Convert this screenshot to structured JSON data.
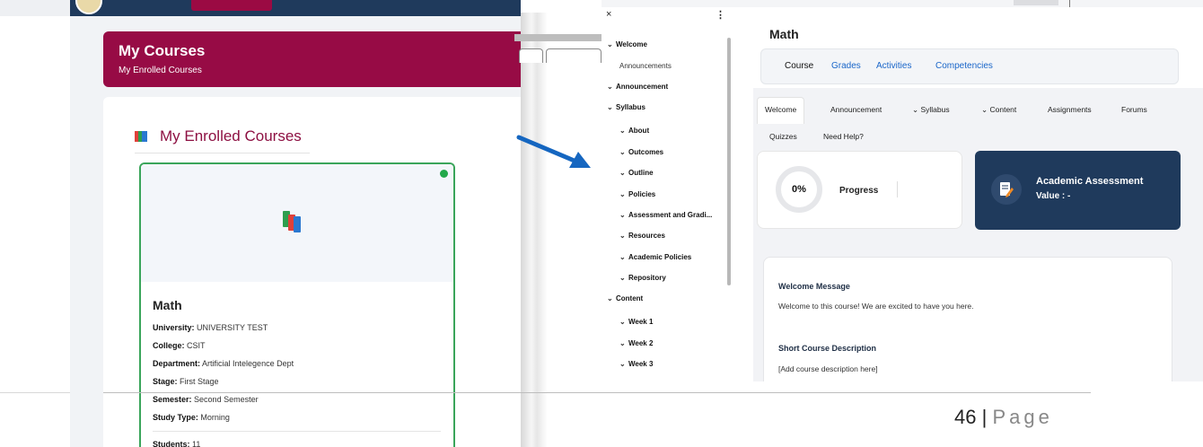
{
  "left_screen": {
    "banner": {
      "title": "My Courses",
      "subtitle": "My Enrolled Courses"
    },
    "section_title": "My Enrolled Courses",
    "course": {
      "name": "Math",
      "status_color": "#22a84a",
      "fields": [
        {
          "label": "University:",
          "value": "UNIVERSITY TEST"
        },
        {
          "label": "College:",
          "value": "CSIT"
        },
        {
          "label": "Department:",
          "value": "Artificial Intelegence Dept"
        },
        {
          "label": "Stage:",
          "value": "First Stage"
        },
        {
          "label": "Semester:",
          "value": "Second Semester"
        },
        {
          "label": "Study Type:",
          "value": "Morning"
        }
      ],
      "students": {
        "label": "Students:",
        "value": "11"
      }
    }
  },
  "right_screen": {
    "sidebar": {
      "close_glyph": "×",
      "more_glyph": "⋮",
      "items": [
        {
          "label": "Welcome",
          "level": 0,
          "chevron": "⌄"
        },
        {
          "label": "Announcements",
          "level": 2,
          "chevron": ""
        },
        {
          "label": "Announcement",
          "level": 0,
          "chevron": "⌄"
        },
        {
          "label": "Syllabus",
          "level": 0,
          "chevron": "⌄"
        },
        {
          "label": "About",
          "level": 1,
          "chevron": "⌄"
        },
        {
          "label": "Outcomes",
          "level": 1,
          "chevron": "⌄"
        },
        {
          "label": "Outline",
          "level": 1,
          "chevron": "⌄"
        },
        {
          "label": "Policies",
          "level": 1,
          "chevron": "⌄"
        },
        {
          "label": "Assessment and Gradi...",
          "level": 1,
          "chevron": "⌄"
        },
        {
          "label": "Resources",
          "level": 1,
          "chevron": "⌄"
        },
        {
          "label": "Academic Policies",
          "level": 1,
          "chevron": "⌄"
        },
        {
          "label": "Repository",
          "level": 1,
          "chevron": "⌄"
        },
        {
          "label": "Content",
          "level": 0,
          "chevron": "⌄"
        },
        {
          "label": "Week 1",
          "level": 1,
          "chevron": "⌄"
        },
        {
          "label": "Week 2",
          "level": 1,
          "chevron": "⌄"
        },
        {
          "label": "Week 3",
          "level": 1,
          "chevron": "⌄"
        }
      ]
    },
    "course_title": "Math",
    "main_tabs": [
      "Course",
      "Grades",
      "Activities",
      "Competencies"
    ],
    "sub_tabs": [
      "Welcome",
      "Announcement",
      "⌄ Syllabus",
      "⌄ Content",
      "Assignments",
      "Forums",
      "Quizzes",
      "Need Help?"
    ],
    "progress": {
      "value_text": "0%",
      "label": "Progress",
      "fraction": 0
    },
    "assessment": {
      "title": "Academic Assessment",
      "value": "Value : -"
    },
    "welcome": {
      "heading": "Welcome Message",
      "text": "Welcome to this course! We are excited to have you here.",
      "desc_heading": "Short Course Description",
      "desc_text": "[Add course description here]"
    }
  },
  "footer": {
    "page_number": "46",
    "separator": "|",
    "page_word": "Page"
  },
  "colors": {
    "maroon": "#970b45",
    "navy": "#1f3a5c",
    "link_blue": "#1a66c9",
    "arrow_blue": "#1566c0"
  }
}
